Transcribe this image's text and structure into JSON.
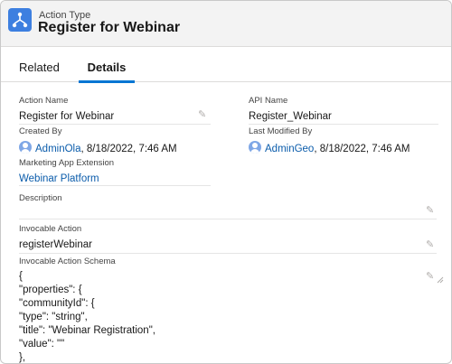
{
  "header": {
    "object_type": "Action Type",
    "title": "Register for Webinar",
    "icon": "flow-icon",
    "icon_color": "#3d7fe0"
  },
  "tabs": [
    {
      "label": "Related",
      "active": false
    },
    {
      "label": "Details",
      "active": true
    }
  ],
  "fields": {
    "action_name": {
      "label": "Action Name",
      "value": "Register for Webinar"
    },
    "api_name": {
      "label": "API Name",
      "value": "Register_Webinar"
    },
    "created_by": {
      "label": "Created By",
      "user": "AdminOla",
      "date": ", 8/18/2022, 7:46 AM"
    },
    "last_modified_by": {
      "label": "Last Modified By",
      "user": "AdminGeo",
      "date": ", 8/18/2022, 7:46 AM"
    },
    "marketing_app_extension": {
      "label": "Marketing App Extension",
      "value": "Webinar Platform"
    },
    "description": {
      "label": "Description",
      "value": ""
    },
    "invocable_action": {
      "label": "Invocable Action",
      "value": "registerWebinar"
    },
    "invocable_action_schema": {
      "label": "Invocable Action Schema",
      "lines": [
        "{",
        "\"properties\": {",
        "\"communityId\": {",
        "\"type\": \"string\",",
        "\"title\": \"Webinar Registration\",",
        "\"value\": \"\"",
        "},"
      ]
    }
  },
  "colors": {
    "link": "#0b5cab",
    "tab_active": "#0176d3"
  }
}
